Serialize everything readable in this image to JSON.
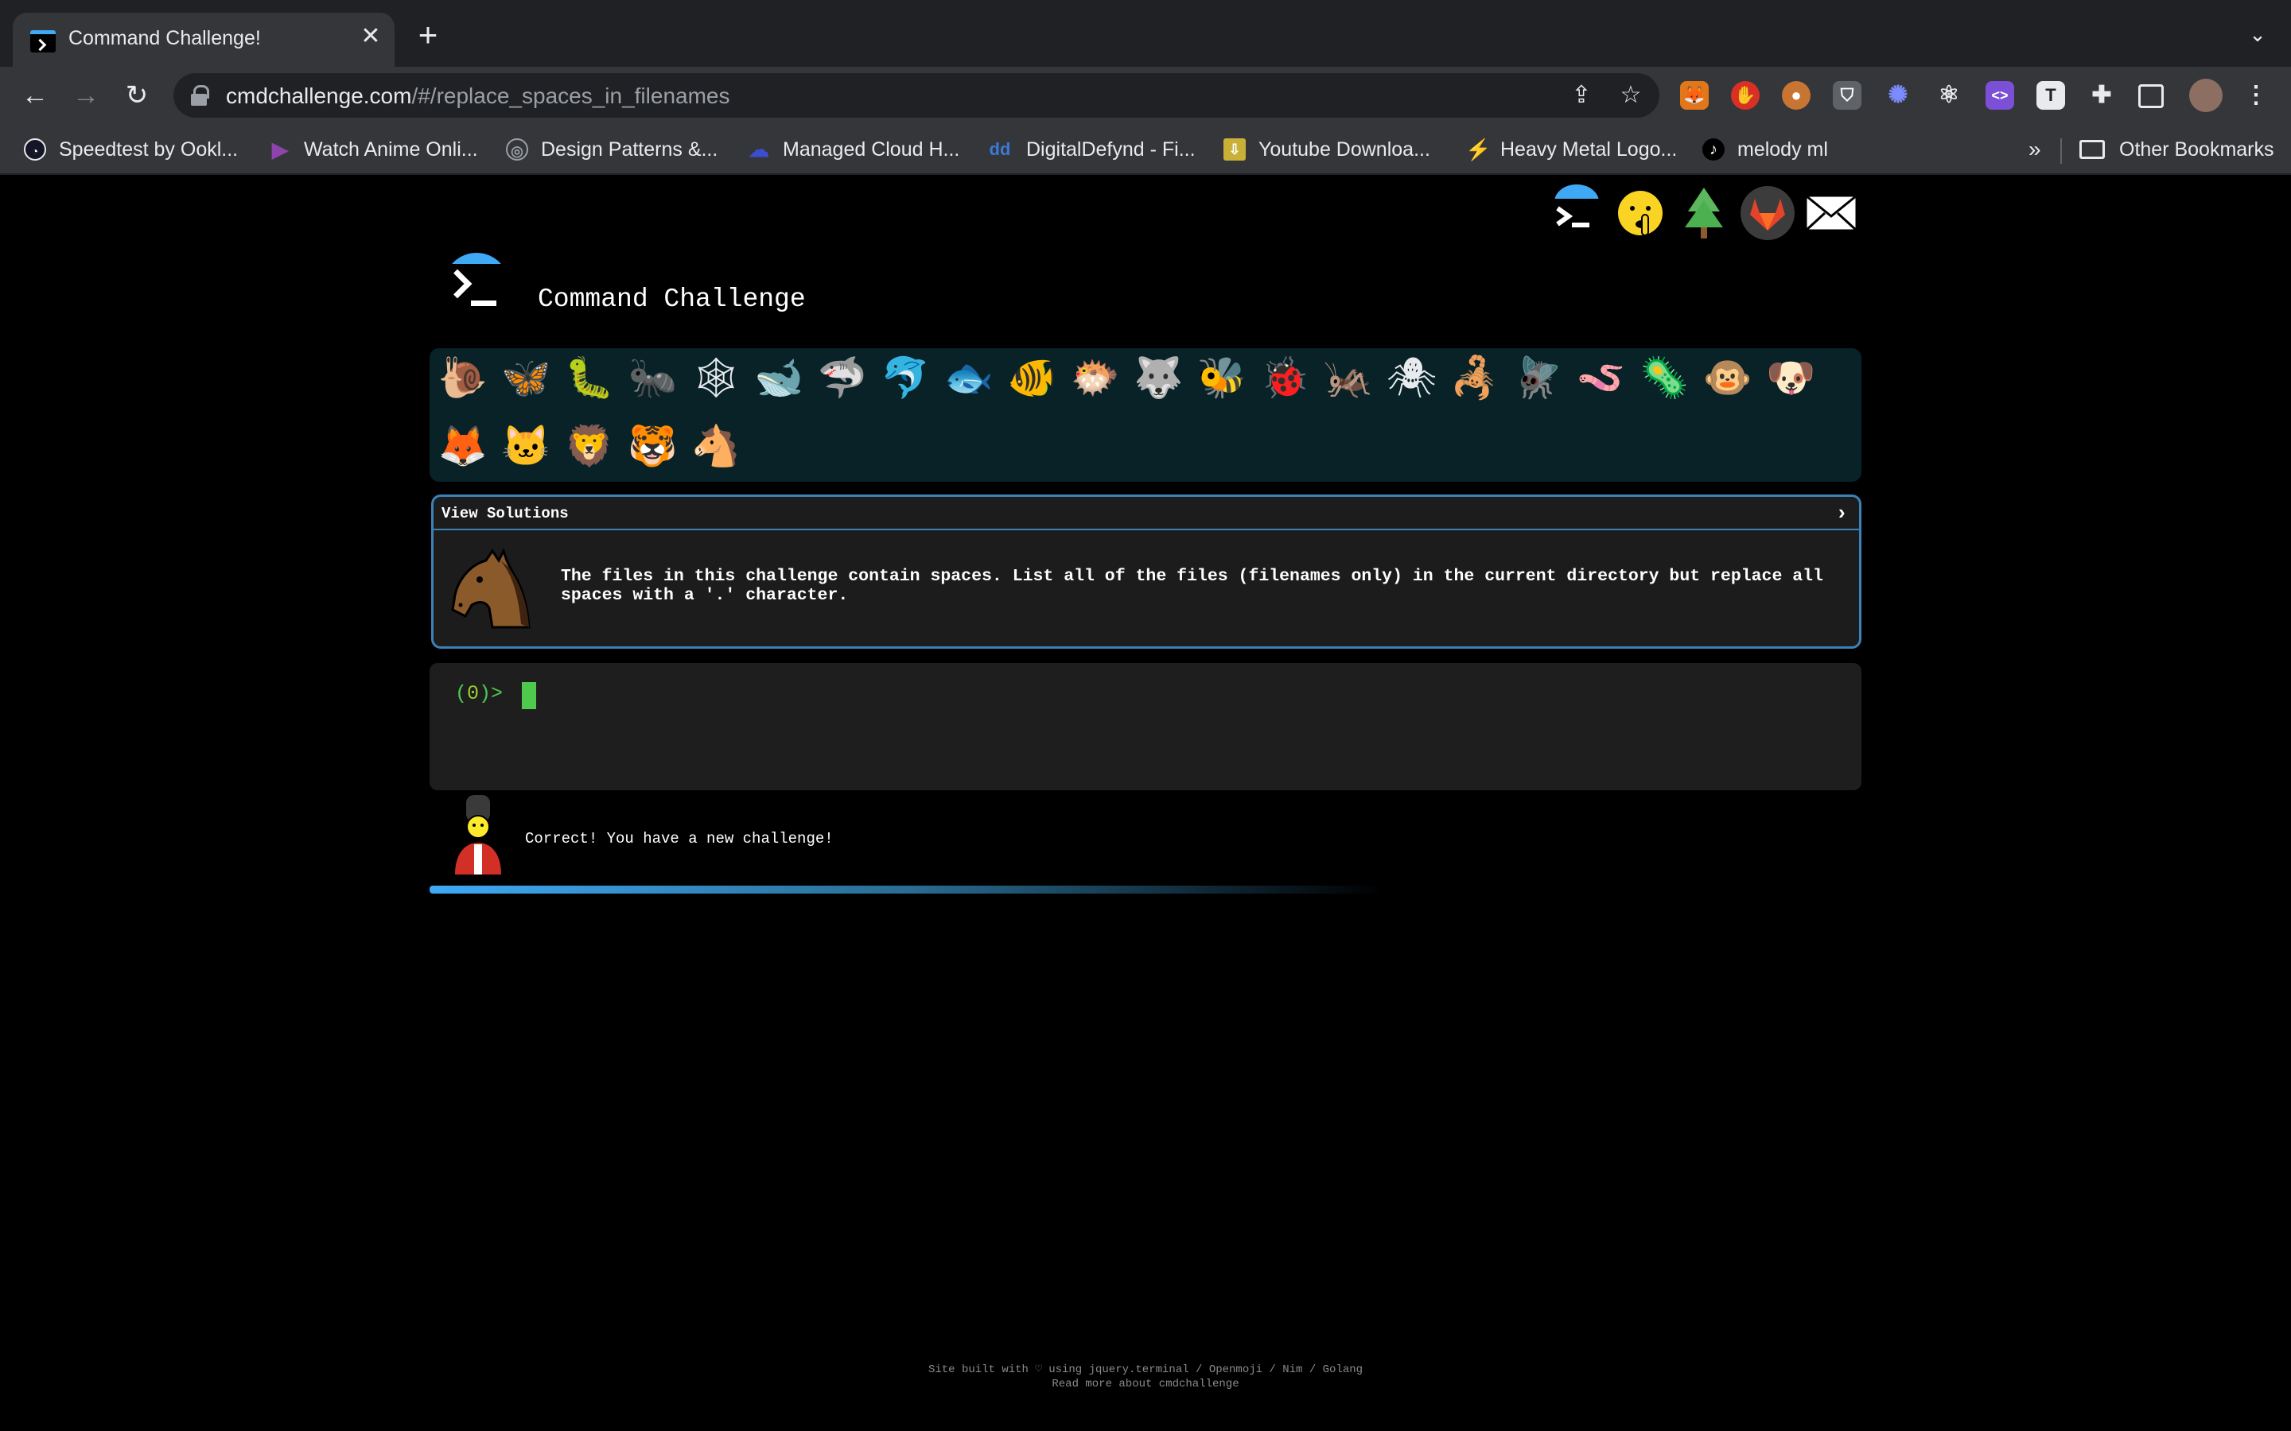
{
  "browser": {
    "tab_title": "Command Challenge!",
    "tab_close": "✕",
    "new_tab": "+",
    "tab_search": "⌄",
    "url_domain": "cmdchallenge.com",
    "url_path": "/#/replace_spaces_in_filenames",
    "bookmarks": [
      {
        "label": "Speedtest by Ookl...",
        "icon": "speedtest-icon"
      },
      {
        "label": "Watch Anime Onli...",
        "icon": "play-icon"
      },
      {
        "label": "Design Patterns &...",
        "icon": "globe-icon"
      },
      {
        "label": "Managed Cloud H...",
        "icon": "cloud-icon"
      },
      {
        "label": "DigitalDefynd - Fi...",
        "icon": "dd-icon"
      },
      {
        "label": "Youtube Downloa...",
        "icon": "download-icon"
      },
      {
        "label": "Heavy Metal Logo...",
        "icon": "guitar-icon"
      },
      {
        "label": "melody ml",
        "icon": "music-note-icon"
      }
    ],
    "bookmarks_more": "»",
    "other_bookmarks": "Other Bookmarks"
  },
  "page": {
    "site_title": "Command Challenge",
    "challenge": {
      "header": "View Solutions",
      "arrow": "›",
      "description": "The files in this challenge contain spaces. List all of the files (filenames only) in the current directory but replace all spaces with a '.' character."
    },
    "terminal": {
      "prompt_open": "(",
      "prompt_num": "0",
      "prompt_close": ")>"
    },
    "result_message": "Correct! You have a new challenge!",
    "footer_line1": "Site built with ♡ using jquery.terminal / Openmoji / Nim / Golang",
    "footer_line2": "Read more about cmdchallenge",
    "animals_row1": [
      "🐌",
      "🦋",
      "🐛",
      "🐜",
      "🕸",
      "🐋",
      "🦈",
      "🐬",
      "🐟",
      "🐠",
      "🐡",
      "🐺",
      "🐝",
      "🐞",
      "🦗",
      "🕷",
      "🦂",
      "🪰",
      "🪱",
      "🦠",
      "🐵",
      "🐶"
    ],
    "animals_row2": [
      "🦊",
      "🐱",
      "🦁",
      "🐯",
      "🐴"
    ]
  },
  "colors": {
    "accent": "#3fa9f5",
    "border": "#3b82b8",
    "prompt_green": "#4ec94e",
    "progress_start": "#3fa9f5"
  },
  "progress": 0.5
}
